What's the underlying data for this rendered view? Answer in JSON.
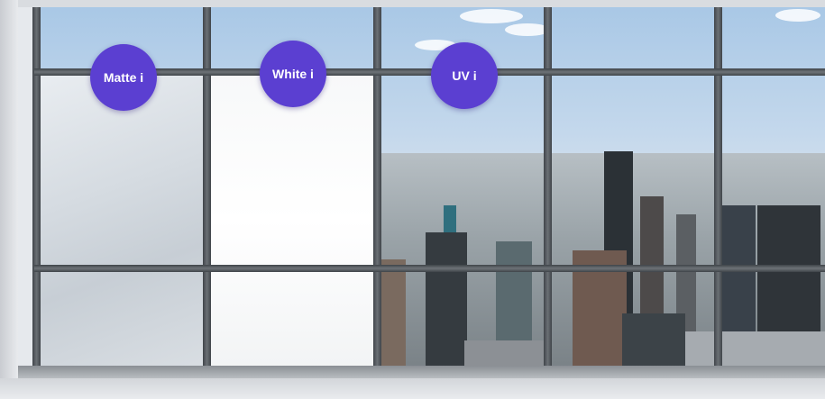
{
  "hotspots": [
    {
      "label": "Matte i"
    },
    {
      "label": "White i"
    },
    {
      "label": "UV i"
    }
  ],
  "colors": {
    "hotspot_bg": "#5b3fd1",
    "hotspot_text": "#ffffff",
    "frame": "#4a4f54"
  },
  "icons": [
    "info-icon"
  ]
}
